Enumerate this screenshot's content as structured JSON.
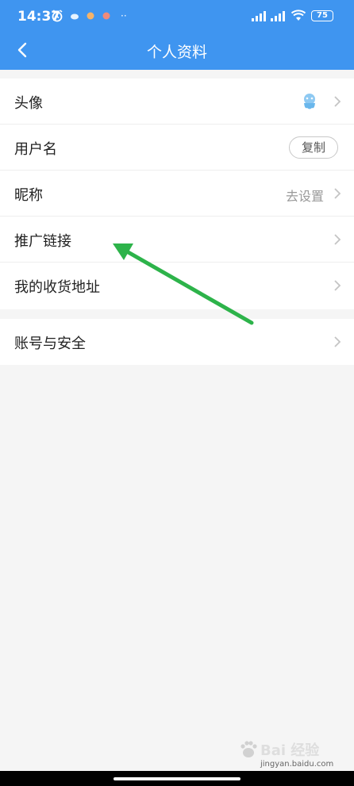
{
  "status_bar": {
    "time": "14:37",
    "battery": "75",
    "dots": "··"
  },
  "header": {
    "title": "个人资料"
  },
  "group1": {
    "rows": [
      {
        "label": "头像"
      },
      {
        "label": "用户名",
        "button": "复制"
      },
      {
        "label": "昵称",
        "value": "去设置"
      },
      {
        "label": "推广链接"
      },
      {
        "label": "我的收货地址"
      }
    ]
  },
  "group2": {
    "rows": [
      {
        "label": "账号与安全"
      }
    ]
  },
  "watermark": {
    "text": "Bai 经验",
    "sub": "jingyan.baidu.com"
  },
  "colors": {
    "header_bg": "#3f95f0",
    "arrow": "#2db34a",
    "page_bg": "#f5f5f5"
  }
}
